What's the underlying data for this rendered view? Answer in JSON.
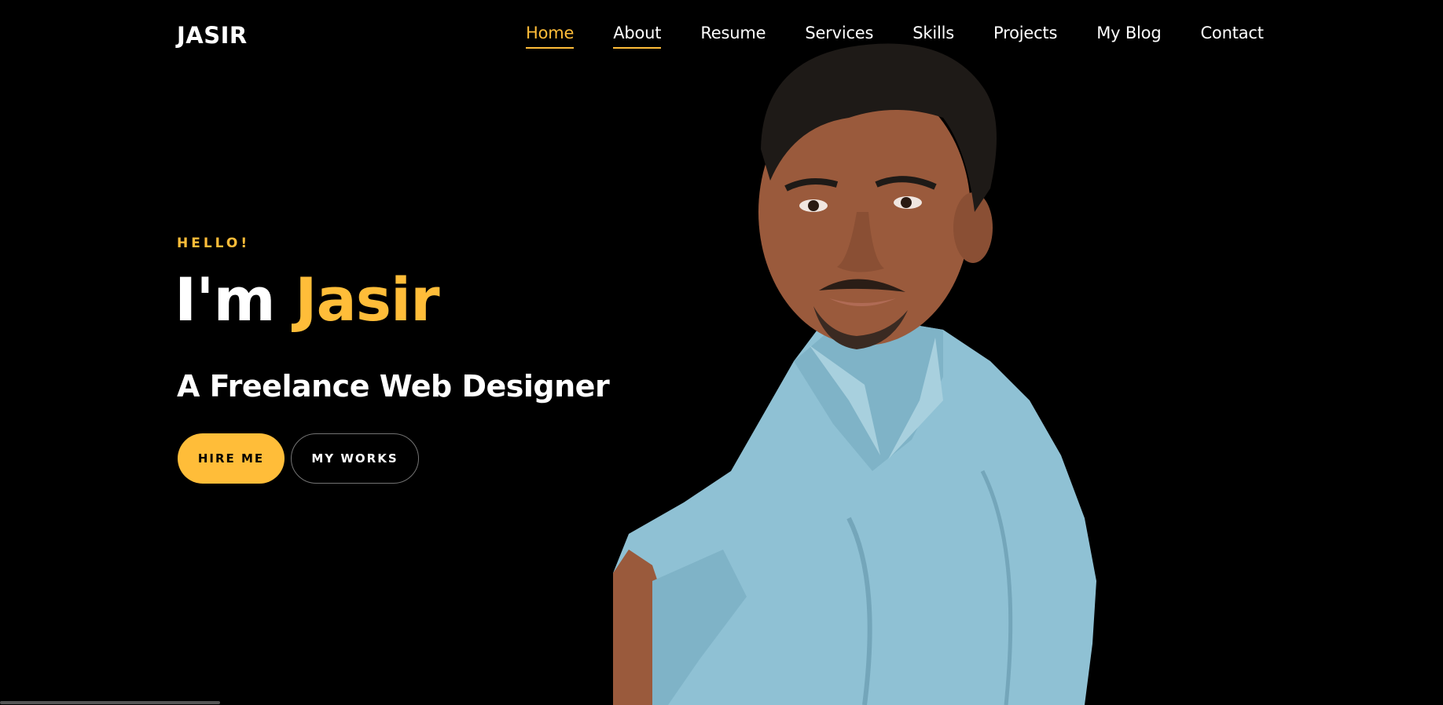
{
  "nav": {
    "logo": "JASIR",
    "items": [
      {
        "label": "Home"
      },
      {
        "label": "About"
      },
      {
        "label": "Resume"
      },
      {
        "label": "Services"
      },
      {
        "label": "Skills"
      },
      {
        "label": "Projects"
      },
      {
        "label": "My Blog"
      },
      {
        "label": "Contact"
      }
    ]
  },
  "hero": {
    "greeting": "HELLO!",
    "intro": "I'm",
    "name": "Jasir",
    "subtitle": "A Freelance Web Designer",
    "primary_button": "HIRE ME",
    "secondary_button": "MY WORKS"
  },
  "colors": {
    "accent": "#ffbd39",
    "background": "#000000",
    "text": "#ffffff",
    "shirt": "#8fc1d4",
    "skin": "#9a5a3c"
  }
}
